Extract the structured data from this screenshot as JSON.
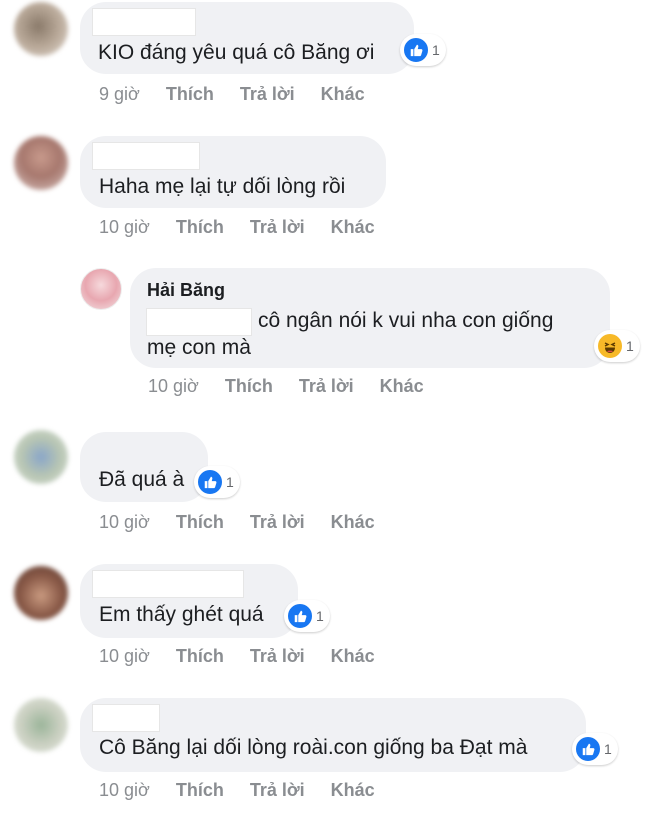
{
  "comments": [
    {
      "text": "KIO đáng yêu quá cô Băng ơi",
      "reaction_count": "1",
      "reaction_type": "like",
      "time": "9 giờ",
      "like": "Thích",
      "reply": "Trả lời",
      "more": "Khác"
    },
    {
      "text": "Haha mẹ lại tự dối lòng rồi",
      "time": "10 giờ",
      "like": "Thích",
      "reply": "Trả lời",
      "more": "Khác",
      "reply_item": {
        "author": "Hải Băng",
        "text_line1": "cô ngân nói k vui nha con giống",
        "text_line2": "mẹ con mà",
        "reaction_count": "1",
        "reaction_type": "haha",
        "time": "10 giờ",
        "like": "Thích",
        "reply": "Trả lời",
        "more": "Khác"
      }
    },
    {
      "text": "Đã quá à",
      "reaction_count": "1",
      "reaction_type": "like",
      "time": "10 giờ",
      "like": "Thích",
      "reply": "Trả lời",
      "more": "Khác"
    },
    {
      "text": "Em thấy ghét quá",
      "reaction_count": "1",
      "reaction_type": "like",
      "time": "10 giờ",
      "like": "Thích",
      "reply": "Trả lời",
      "more": "Khác"
    },
    {
      "text": "Cô Băng lại dối lòng roài.con giống ba Đạt mà",
      "reaction_count": "1",
      "reaction_type": "like",
      "time": "10 giờ",
      "like": "Thích",
      "reply": "Trả lời",
      "more": "Khác"
    }
  ],
  "colors": {
    "bubble": "#f0f1f4",
    "like_blue": "#1877f2",
    "haha_yellow": "#f7b928",
    "meta_gray": "#8a8d91"
  }
}
